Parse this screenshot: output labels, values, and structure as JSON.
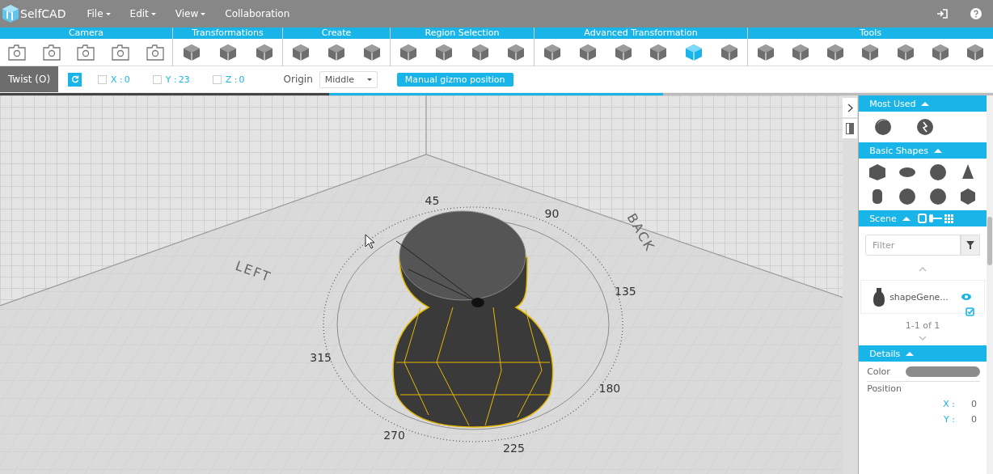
{
  "app": {
    "name": "SelfCAD",
    "menus": [
      {
        "label": "File",
        "dropdown": true
      },
      {
        "label": "Edit",
        "dropdown": true
      },
      {
        "label": "View",
        "dropdown": true
      },
      {
        "label": "Collaboration",
        "dropdown": false
      }
    ]
  },
  "toolbar": {
    "groups": [
      {
        "label": "Camera",
        "tools": [
          {
            "selected": false
          },
          {
            "selected": false
          },
          {
            "selected": false
          },
          {
            "selected": false
          },
          {
            "selected": false
          }
        ]
      },
      {
        "label": "Transformations",
        "tools": [
          {
            "selected": false
          },
          {
            "selected": false
          },
          {
            "selected": false
          }
        ]
      },
      {
        "label": "Create",
        "tools": [
          {
            "selected": false
          },
          {
            "selected": false
          },
          {
            "selected": false
          }
        ]
      },
      {
        "label": "Region Selection",
        "tools": [
          {
            "selected": false
          },
          {
            "selected": false
          },
          {
            "selected": false
          },
          {
            "selected": false
          }
        ]
      },
      {
        "label": "Advanced Transformation",
        "tools": [
          {
            "selected": false
          },
          {
            "selected": false
          },
          {
            "selected": false
          },
          {
            "selected": false
          },
          {
            "selected": true
          },
          {
            "selected": false
          }
        ]
      },
      {
        "label": "Tools",
        "tools": [
          {
            "selected": false
          },
          {
            "selected": false
          },
          {
            "selected": false
          },
          {
            "selected": false
          },
          {
            "selected": false
          },
          {
            "selected": false
          },
          {
            "selected": false
          }
        ]
      }
    ]
  },
  "options": {
    "tool_tab": "Twist (O)",
    "axes": [
      {
        "label": "X :",
        "value": "0",
        "checked": false
      },
      {
        "label": "Y :",
        "value": "23",
        "checked": false
      },
      {
        "label": "Z :",
        "value": "0",
        "checked": false
      }
    ],
    "origin_label": "Origin",
    "origin_value": "Middle",
    "gizmo_button": "Manual gizmo position"
  },
  "viewport": {
    "wall_labels": [
      "LEFT",
      "BACK"
    ],
    "dial_labels": [
      "45",
      "90",
      "135",
      "180",
      "225",
      "270",
      "315"
    ]
  },
  "panel": {
    "sections": [
      {
        "kind": "most_used",
        "title": "Most Used",
        "expanded": true
      },
      {
        "kind": "basic_shapes",
        "title": "Basic Shapes",
        "expanded": true
      },
      {
        "kind": "scene",
        "title": "Scene",
        "expanded": true,
        "filter_placeholder": "Filter",
        "items": [
          {
            "name": "shapeGene...",
            "visible": true,
            "selected": true
          }
        ],
        "count_text": "1-1 of 1"
      },
      {
        "kind": "details",
        "title": "Details",
        "expanded": true,
        "color_label": "Color",
        "position_label": "Position",
        "coords": [
          {
            "axis": "X :",
            "value": "0"
          },
          {
            "axis": "Y :",
            "value": "0"
          }
        ]
      }
    ]
  }
}
